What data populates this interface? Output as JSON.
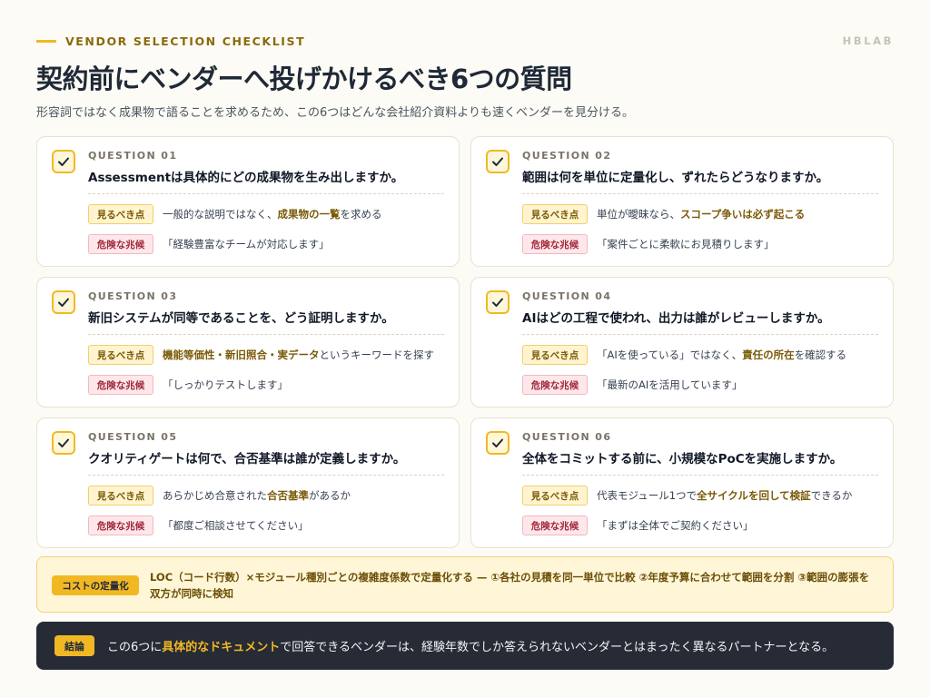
{
  "header": {
    "eyebrow": "VENDOR SELECTION CHECKLIST",
    "brand": "HBLAB",
    "title": "契約前にベンダーへ投げかけるべき6つの質問",
    "subtitle": "形容詞ではなく成果物で語ることを求めるため、この6つはどんな会社紹介資料よりも速くベンダーを見分ける。"
  },
  "labels": {
    "look": "見るべき点",
    "warn": "危険な兆候"
  },
  "questions": [
    {
      "num": "QUESTION 01",
      "text": "Assessmentは具体的にどの成果物を生み出しますか。",
      "look_pre": "一般的な説明ではなく、",
      "look_em": "成果物の一覧",
      "look_post": "を求める",
      "warn": "「経験豊富なチームが対応します」"
    },
    {
      "num": "QUESTION 02",
      "text": "範囲は何を単位に定量化し、ずれたらどうなりますか。",
      "look_pre": "単位が曖昧なら、",
      "look_em": "スコープ争いは必ず起こる",
      "look_post": "",
      "warn": "「案件ごとに柔軟にお見積りします」"
    },
    {
      "num": "QUESTION 03",
      "text": "新旧システムが同等であることを、どう証明しますか。",
      "look_pre": "",
      "look_em": "機能等価性・新旧照合・実データ",
      "look_post": "というキーワードを探す",
      "warn": "「しっかりテストします」"
    },
    {
      "num": "QUESTION 04",
      "text": "AIはどの工程で使われ、出力は誰がレビューしますか。",
      "look_pre": "「AIを使っている」ではなく、",
      "look_em": "責任の所在",
      "look_post": "を確認する",
      "warn": "「最新のAIを活用しています」"
    },
    {
      "num": "QUESTION 05",
      "text": "クオリティゲートは何で、合否基準は誰が定義しますか。",
      "look_pre": "あらかじめ合意された",
      "look_em": "合否基準",
      "look_post": "があるか",
      "warn": "「都度ご相談させてください」"
    },
    {
      "num": "QUESTION 06",
      "text": "全体をコミットする前に、小規模なPoCを実施しますか。",
      "look_pre": "代表モジュール1つで",
      "look_em": "全サイクルを回して検証",
      "look_post": "できるか",
      "warn": "「まずは全体でご契約ください」"
    }
  ],
  "cost": {
    "tag": "コストの定量化",
    "text": "LOC（コード行数）×モジュール種別ごとの複雑度係数で定量化する — ①各社の見積を同一単位で比較 ②年度予算に合わせて範囲を分割 ③範囲の膨張を双方が同時に検知"
  },
  "conclusion": {
    "tag": "結論",
    "pre": "この6つに",
    "em": "具体的なドキュメント",
    "post": "で回答できるベンダーは、経験年数でしか答えられないベンダーとはまったく異なるパートナーとなる。"
  },
  "colors": {
    "accent": "#f2b824",
    "dark": "#262b36",
    "danger": "#a1283a"
  },
  "icons": {
    "card_check": "check-icon"
  }
}
